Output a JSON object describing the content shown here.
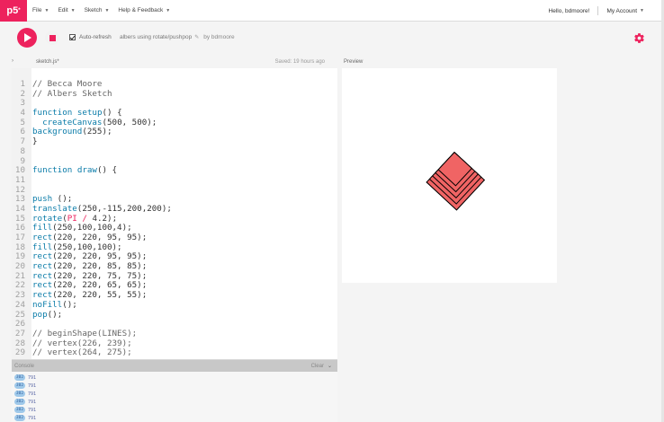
{
  "nav": {
    "logo": "p5",
    "logo_sup": "*",
    "menus": [
      {
        "label": "File"
      },
      {
        "label": "Edit"
      },
      {
        "label": "Sketch"
      },
      {
        "label": "Help & Feedback"
      }
    ],
    "greeting": "Hello, bdmoore!",
    "account_label": "My Account",
    "caret_icon": "chevron-down-icon"
  },
  "toolbar": {
    "play_icon": "play-icon",
    "stop_icon": "stop-icon",
    "autorefresh_label": "Auto-refresh",
    "autorefresh_checked": true,
    "sketch_name": "albers using rotate/pushpop",
    "edit_icon": "pencil-icon",
    "by_label": "by bdmoore",
    "settings_icon": "gear-icon",
    "accent": "#ed225d"
  },
  "editor": {
    "filename": "sketch.js",
    "modified_marker": "*",
    "saved_text": "Saved: 19 hours ago",
    "lines": [
      "// Becca Moore",
      "// Albers Sketch",
      "",
      "function setup() {",
      "  createCanvas(500, 500);",
      "background(255);",
      "}",
      "",
      "",
      "function draw() {",
      "",
      "",
      "push ();",
      "translate(250,-115,200,200);",
      "rotate(PI / 4.2);",
      "fill(250,100,100,4);",
      "rect(220, 220, 95, 95);",
      "fill(250,100,100);",
      "rect(220, 220, 95, 95);",
      "rect(220, 220, 85, 85);",
      "rect(220, 220, 75, 75);",
      "rect(220, 220, 65, 65);",
      "rect(220, 220, 55, 55);",
      "noFill();",
      "pop();",
      "",
      "// beginShape(LINES);",
      "// vertex(226, 239);",
      "// vertex(264, 275);"
    ]
  },
  "preview": {
    "label": "Preview",
    "squares": [
      {
        "size": 95,
        "fill": "#f06464"
      },
      {
        "size": 95,
        "fill": "#f06464"
      },
      {
        "size": 85,
        "fill": "#f06464"
      },
      {
        "size": 75,
        "fill": "#f06464"
      },
      {
        "size": 65,
        "fill": "#f06464"
      },
      {
        "size": 55,
        "fill": "#f06464"
      }
    ]
  },
  "console": {
    "label": "Console",
    "clear_label": "Clear",
    "entries": [
      {
        "count": "302",
        "text": "791"
      },
      {
        "count": "302",
        "text": "791"
      },
      {
        "count": "302",
        "text": "791"
      },
      {
        "count": "302",
        "text": "791"
      },
      {
        "count": "302",
        "text": "791"
      },
      {
        "count": "302",
        "text": "791"
      }
    ]
  }
}
